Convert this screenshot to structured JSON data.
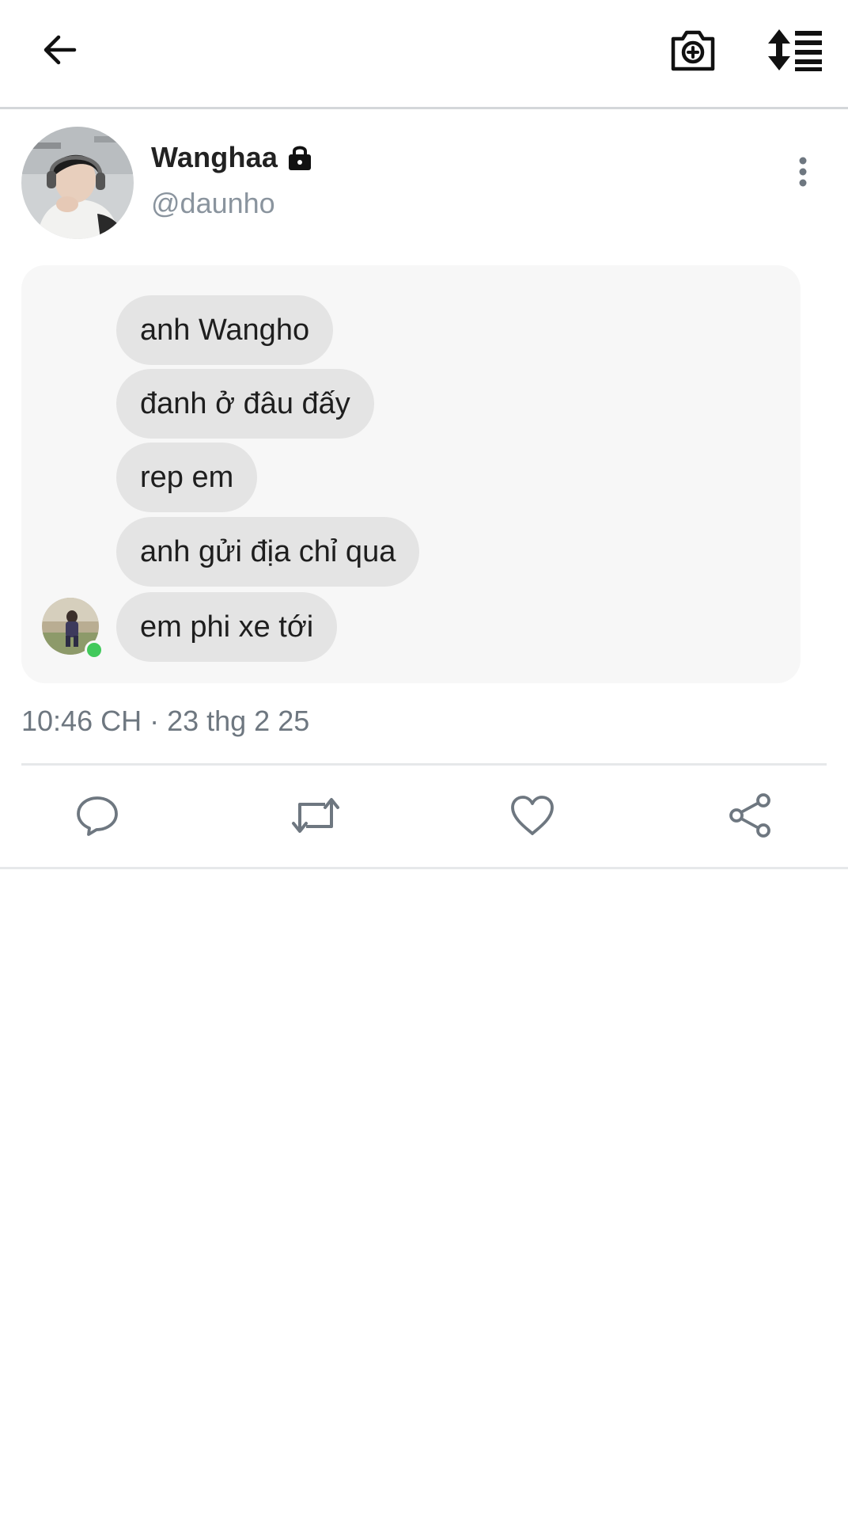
{
  "header": {
    "back_icon": "arrow-left-icon",
    "camera_icon": "camera-add-icon",
    "sort_icon": "sort-list-icon"
  },
  "post": {
    "display_name": "Wanghaa",
    "lock_icon": "lock-icon",
    "handle": "@daunho",
    "more_icon": "more-vertical-icon",
    "messages": [
      "anh Wangho",
      "đanh ở đâu đấy",
      "rep em",
      "anh gửi địa chỉ qua",
      "em phi xe tới"
    ],
    "timestamp": "10:46 CH · 23 thg 2 25"
  },
  "actions": {
    "reply_icon": "comment-icon",
    "retweet_icon": "retweet-icon",
    "like_icon": "heart-icon",
    "share_icon": "share-icon"
  },
  "colors": {
    "icon_gray": "#6e7780",
    "online": "#41c95b",
    "bubble": "#e4e4e4",
    "card": "#f7f7f7"
  }
}
